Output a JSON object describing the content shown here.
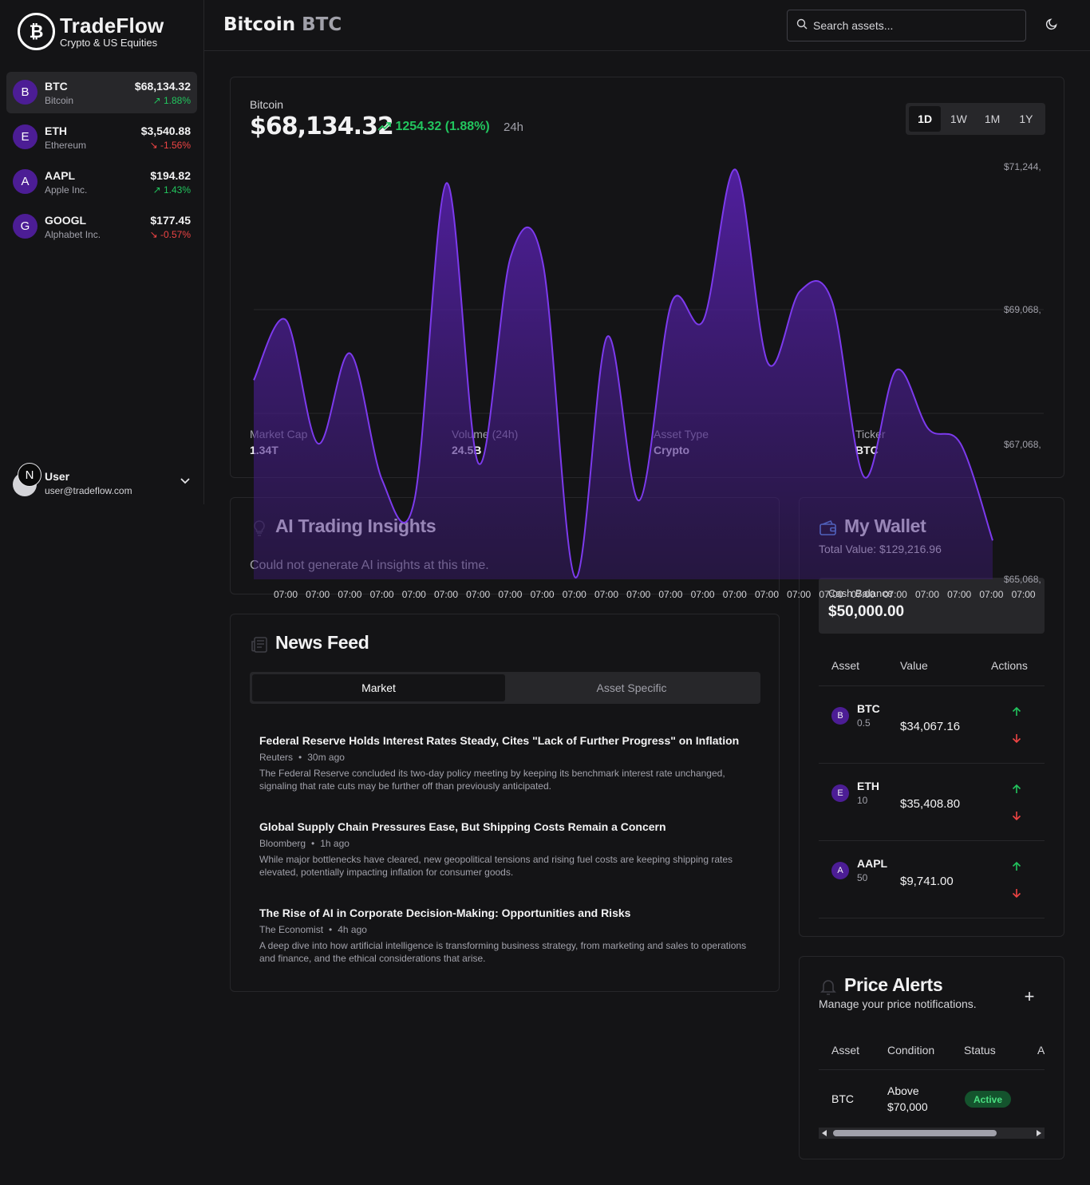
{
  "brand": {
    "name": "TradeFlow",
    "tagline": "Crypto & US Equities",
    "logo_glyph": "₿"
  },
  "colors": {
    "accent": "#6d28d9",
    "line": "#7c3aed",
    "up": "#22c55e",
    "down": "#ef4444",
    "bg": "#141416",
    "panel": "#27272a"
  },
  "sidebar": {
    "assets": [
      {
        "initial": "B",
        "symbol": "BTC",
        "name": "Bitcoin",
        "price": "$68,134.32",
        "change": "1.88%",
        "direction": "up",
        "active": true
      },
      {
        "initial": "E",
        "symbol": "ETH",
        "name": "Ethereum",
        "price": "$3,540.88",
        "change": "-1.56%",
        "direction": "down",
        "active": false
      },
      {
        "initial": "A",
        "symbol": "AAPL",
        "name": "Apple Inc.",
        "price": "$194.82",
        "change": "1.43%",
        "direction": "up",
        "active": false
      },
      {
        "initial": "G",
        "symbol": "GOOGL",
        "name": "Alphabet Inc.",
        "price": "$177.45",
        "change": "-0.57%",
        "direction": "down",
        "active": false
      }
    ],
    "user": {
      "initial": "N",
      "name": "User",
      "email": "user@tradeflow.com"
    }
  },
  "header": {
    "title": "Bitcoin",
    "symbol": "BTC",
    "search_placeholder": "Search assets...",
    "theme_icon": "moon-icon"
  },
  "price_card": {
    "asset_name": "Bitcoin",
    "price": "$68,134.32",
    "change": "1254.32 (1.88%)",
    "period": "24h",
    "ranges": [
      "1D",
      "1W",
      "1M",
      "1Y"
    ],
    "active_range": "1D",
    "stats": [
      {
        "label": "Market Cap",
        "value": "1.34T"
      },
      {
        "label": "Volume (24h)",
        "value": "24.5B"
      },
      {
        "label": "Asset Type",
        "value": "Crypto"
      },
      {
        "label": "Ticker",
        "value": "BTC"
      }
    ]
  },
  "chart_data": {
    "type": "area",
    "x": [
      "07:00",
      "07:00",
      "07:00",
      "07:00",
      "07:00",
      "07:00",
      "07:00",
      "07:00",
      "07:00",
      "07:00",
      "07:00",
      "07:00",
      "07:00",
      "07:00",
      "07:00",
      "07:00",
      "07:00",
      "07:00",
      "07:00",
      "07:00",
      "07:00",
      "07:00",
      "07:00",
      "07:00"
    ],
    "series": [
      {
        "values": [
          68050,
          68950,
          67100,
          68450,
          66550,
          66250,
          71000,
          66800,
          69900,
          69800,
          65100,
          68700,
          66250,
          69200,
          68950,
          71200,
          68310,
          69380,
          69230,
          66600,
          68200,
          67320,
          67100,
          65650
        ]
      }
    ],
    "y_ticks": [
      "$71,244,",
      "$69,068,",
      "$67,068,",
      "$65,068,"
    ],
    "ylim": [
      65068,
      71244
    ],
    "grid": "horizontal"
  },
  "ai_insights": {
    "title": "AI Trading Insights",
    "message": "Could not generate AI insights at this time."
  },
  "wallet": {
    "title": "My Wallet",
    "total": "Total Value: $129,216.96",
    "cash_label": "Cash Balance",
    "cash_value": "$50,000.00",
    "columns": [
      "Asset",
      "Value",
      "Actions"
    ],
    "holdings": [
      {
        "initial": "B",
        "symbol": "BTC",
        "qty": "0.5",
        "value": "$34,067.16"
      },
      {
        "initial": "E",
        "symbol": "ETH",
        "qty": "10",
        "value": "$35,408.80"
      },
      {
        "initial": "A",
        "symbol": "AAPL",
        "qty": "50",
        "value": "$9,741.00"
      }
    ]
  },
  "news": {
    "title": "News Feed",
    "tabs": [
      "Market",
      "Asset Specific"
    ],
    "active_tab": "Market",
    "items": [
      {
        "title": "Federal Reserve Holds Interest Rates Steady, Cites \"Lack of Further Progress\" on Inflation",
        "source": "Reuters",
        "time": "30m ago",
        "summary": "The Federal Reserve concluded its two-day policy meeting by keeping its benchmark interest rate unchanged, signaling that rate cuts may be further off than previously anticipated."
      },
      {
        "title": "Global Supply Chain Pressures Ease, But Shipping Costs Remain a Concern",
        "source": "Bloomberg",
        "time": "1h ago",
        "summary": "While major bottlenecks have cleared, new geopolitical tensions and rising fuel costs are keeping shipping rates elevated, potentially impacting inflation for consumer goods."
      },
      {
        "title": "The Rise of AI in Corporate Decision-Making: Opportunities and Risks",
        "source": "The Economist",
        "time": "4h ago",
        "summary": "A deep dive into how artificial intelligence is transforming business strategy, from marketing and sales to operations and finance, and the ethical considerations that arise."
      }
    ]
  },
  "alerts": {
    "title": "Price Alerts",
    "subtitle": "Manage your price notifications.",
    "add_label": "+",
    "columns": [
      "Asset",
      "Condition",
      "Status",
      "A"
    ],
    "rows": [
      {
        "asset": "BTC",
        "condition_line1": "Above",
        "condition_line2": "$70,000",
        "status": "Active"
      }
    ]
  }
}
